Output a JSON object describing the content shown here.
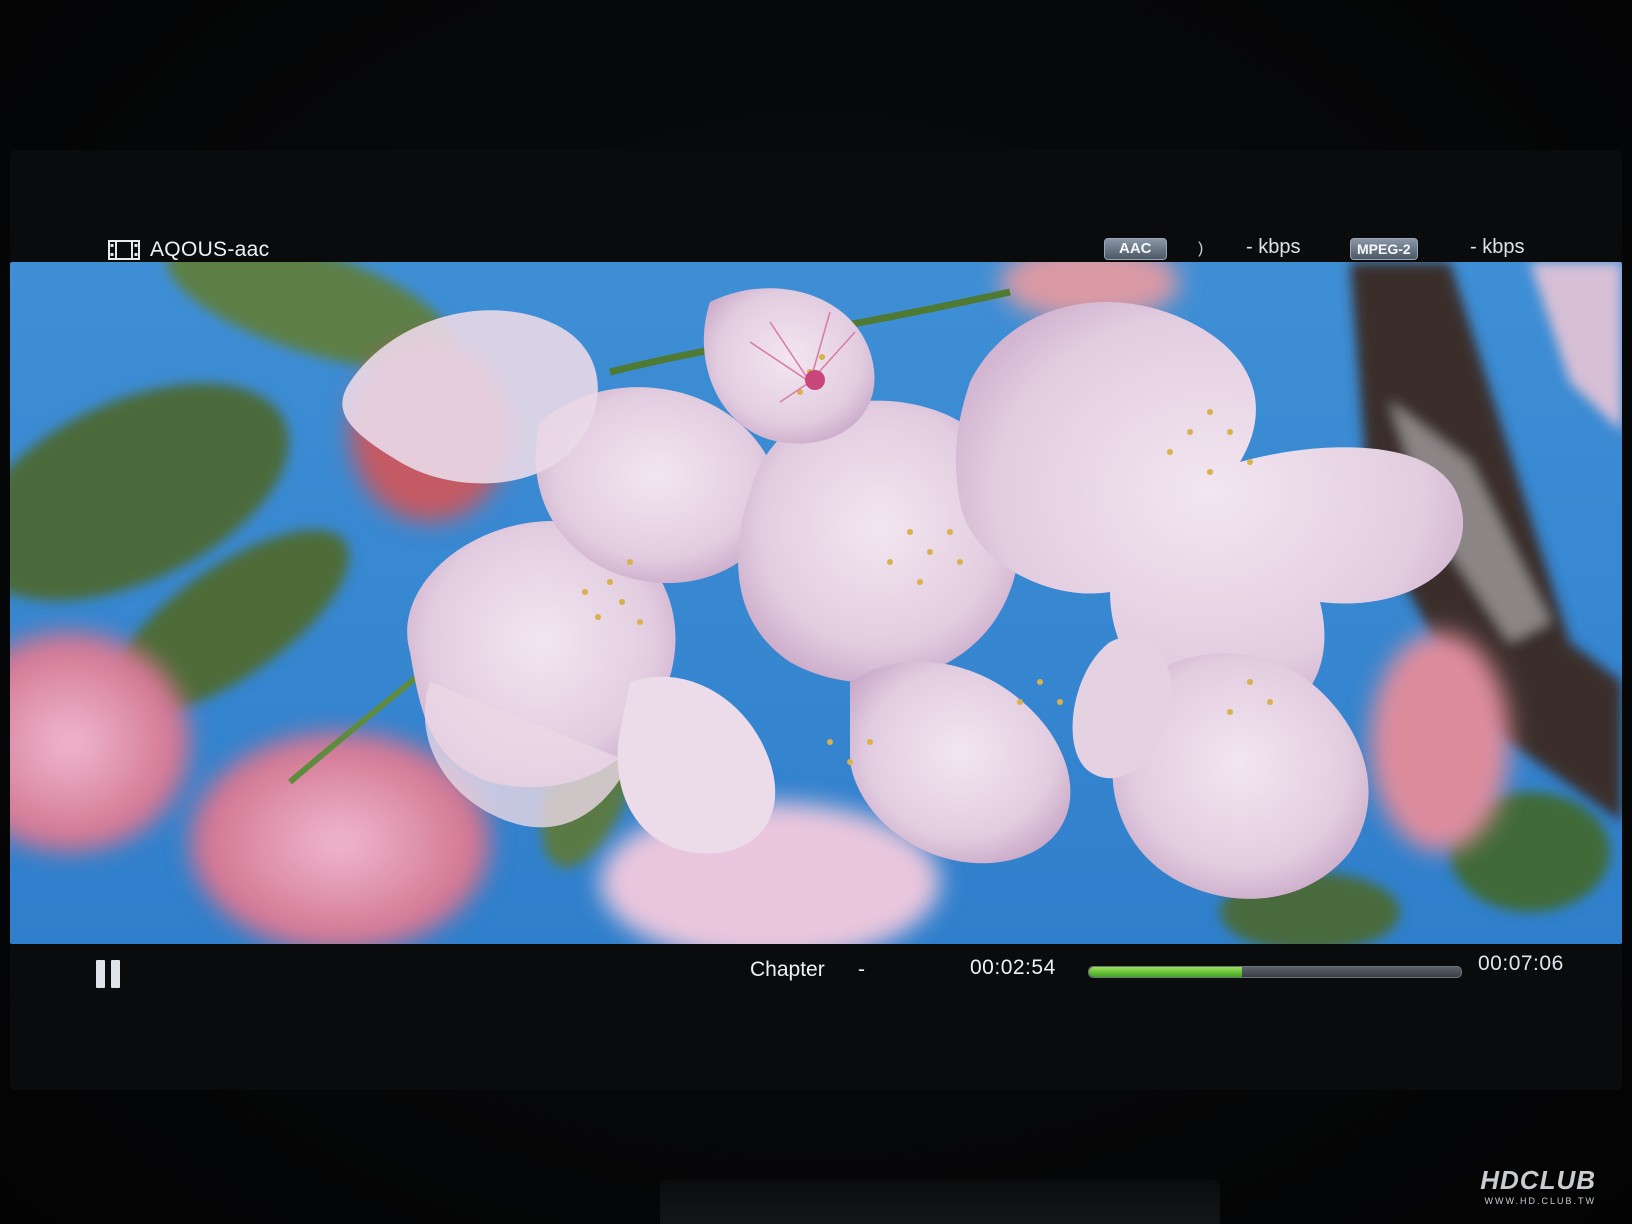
{
  "player": {
    "title": "AQOUS-aac",
    "audio_codec": "AAC",
    "audio_bitrate": "- kbps",
    "video_codec": "MPEG-2",
    "video_bitrate": "- kbps",
    "chapter_label": "Chapter",
    "chapter_value": "-",
    "time_current": "00:02:54",
    "time_total": "00:07:06",
    "progress_fraction": 0.41
  },
  "icons": {
    "title_icon": "film-icon",
    "audio_indicator": "speaker-wave-icon",
    "play_state": "pause-icon"
  },
  "colors": {
    "progress_fill": "#6cc33a",
    "background": "#050607",
    "sky": "#3f8fd6"
  },
  "watermark": {
    "logo": "HDCLUB",
    "subtitle": "WWW.HD.CLUB.TW"
  }
}
